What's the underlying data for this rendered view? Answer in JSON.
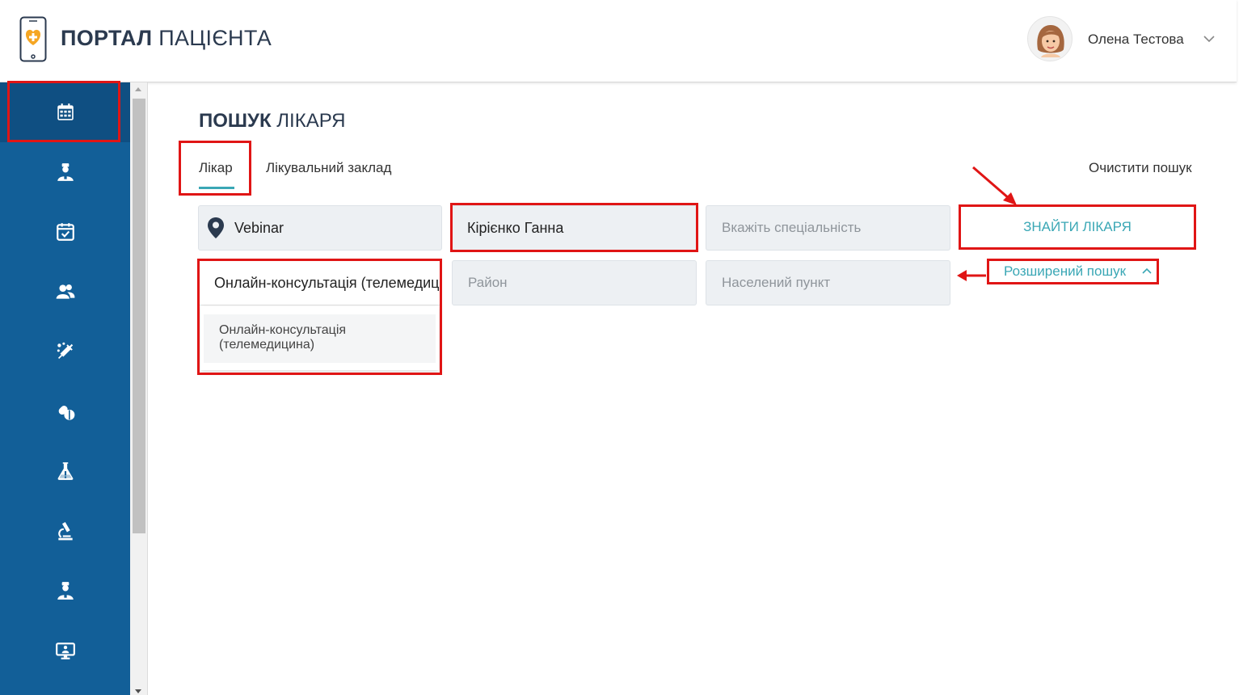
{
  "header": {
    "logo_bold": "ПОРТАЛ",
    "logo_light": "ПАЦІЄНТА",
    "user_name": "Олена Тестова"
  },
  "sidebar": {
    "items": [
      {
        "icon": "calendar-icon",
        "active": true
      },
      {
        "icon": "doctor-icon"
      },
      {
        "icon": "calendar-check-icon"
      },
      {
        "icon": "patients-icon"
      },
      {
        "icon": "vaccine-icon"
      },
      {
        "icon": "pills-icon"
      },
      {
        "icon": "flask-icon"
      },
      {
        "icon": "microscope-icon"
      },
      {
        "icon": "doctor-icon"
      },
      {
        "icon": "telemedicine-icon"
      }
    ]
  },
  "main": {
    "title_bold": "ПОШУК",
    "title_light": "ЛІКАРЯ",
    "tabs": [
      {
        "label": "Лікар",
        "active": true
      },
      {
        "label": "Лікувальний заклад"
      }
    ],
    "clear_label": "Очистити пошук",
    "fields": {
      "location_value": "Vebinar",
      "doctor_value": "Кірієнко Ганна",
      "specialty_placeholder": "Вкажіть спеціальність",
      "consult_value": "Онлайн-консультація (телемедицина)",
      "district_placeholder": "Район",
      "settlement_placeholder": "Населений пункт"
    },
    "find_button": "ЗНАЙТИ ЛІКАРЯ",
    "advanced_link": "Розширений пошук",
    "dropdown_options": [
      "Онлайн-консультація (телемедицина)"
    ]
  },
  "colors": {
    "sidebar": "#125f98",
    "accent": "#3aa7b5",
    "highlight": "#e01515",
    "logo_heart": "#f5a623"
  }
}
